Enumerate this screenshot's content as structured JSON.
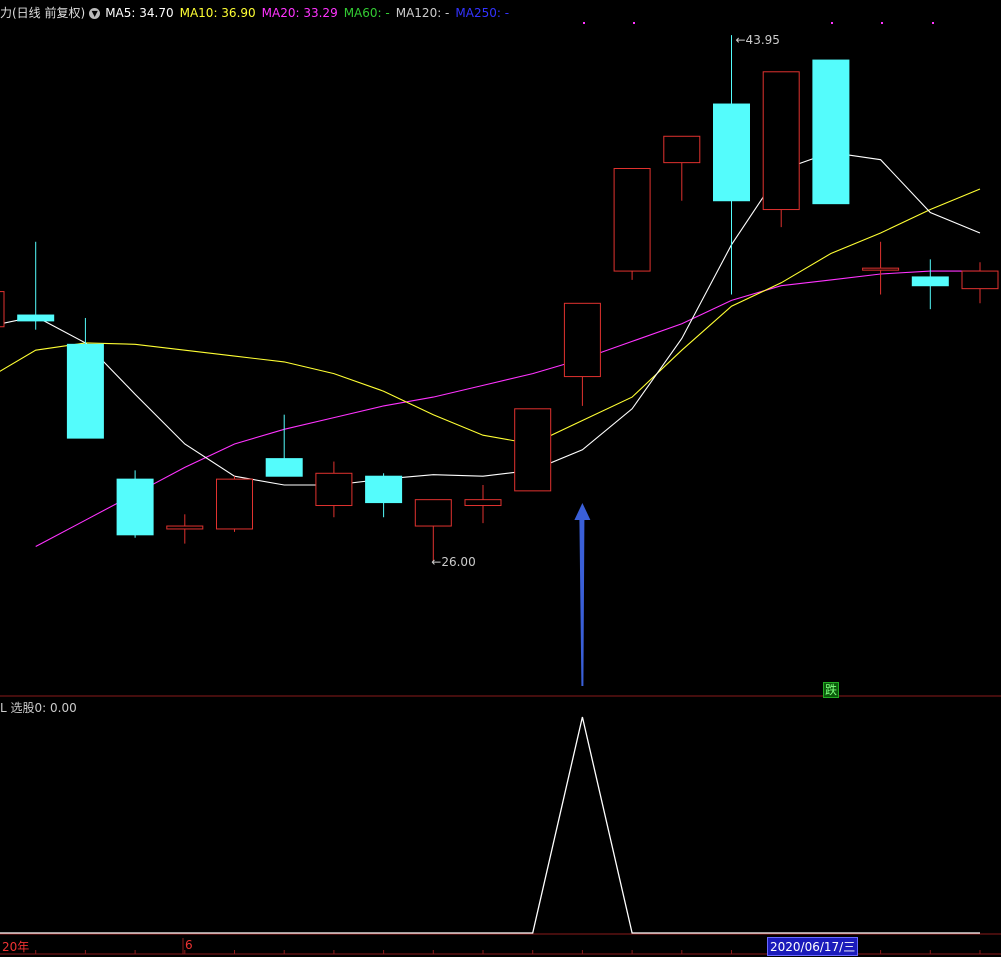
{
  "header": {
    "title": "力(日线 前复权)",
    "ma5": "MA5: 34.70",
    "ma10": "MA10: 36.90",
    "ma20": "MA20: 33.29",
    "ma60": "MA60: -",
    "ma120": "MA120: -",
    "ma250": "MA250: -"
  },
  "sub_indicator": {
    "label": "L  选股0: 0.00"
  },
  "axis": {
    "year_label": "20年",
    "month_label": "6",
    "date_badge": "2020/06/17/三"
  },
  "signal_badge": "跌",
  "colors": {
    "up": "#e0322f",
    "down": "#54fcfc",
    "ma5": "#ffffff",
    "ma10": "#ffff33",
    "ma20": "#ff33ff",
    "ma60": "#33cc33",
    "ma120": "#cccccc",
    "ma250": "#3333ff",
    "signal": "#3a5fd8",
    "grid": "#8a1a1a"
  },
  "chart_data": {
    "type": "candlestick",
    "price_axis": {
      "min": 21.4,
      "max": 45.15
    },
    "annotations": {
      "high": "43.95",
      "low": "26.00"
    },
    "candles": [
      {
        "open": 34.0,
        "close": 35.2,
        "high": 35.2,
        "low": 34.0
      },
      {
        "open": 34.4,
        "close": 34.2,
        "high": 36.9,
        "low": 33.9
      },
      {
        "open": 33.4,
        "close": 30.2,
        "high": 34.3,
        "low": 30.2
      },
      {
        "open": 28.8,
        "close": 26.9,
        "high": 29.1,
        "low": 26.8
      },
      {
        "open": 27.1,
        "close": 27.2,
        "high": 27.6,
        "low": 26.6
      },
      {
        "open": 27.1,
        "close": 28.8,
        "high": 28.9,
        "low": 27.0
      },
      {
        "open": 29.5,
        "close": 28.9,
        "high": 31.0,
        "low": 28.9
      },
      {
        "open": 27.9,
        "close": 29.0,
        "high": 29.4,
        "low": 27.5
      },
      {
        "open": 28.9,
        "close": 28.0,
        "high": 29.0,
        "low": 27.5
      },
      {
        "open": 27.2,
        "close": 28.1,
        "high": 28.1,
        "low": 26.0
      },
      {
        "open": 27.9,
        "close": 28.1,
        "high": 28.6,
        "low": 27.3
      },
      {
        "open": 28.4,
        "close": 31.2,
        "high": 31.2,
        "low": 28.4
      },
      {
        "open": 32.3,
        "close": 34.8,
        "high": 34.8,
        "low": 31.3
      },
      {
        "open": 35.9,
        "close": 39.4,
        "high": 39.4,
        "low": 35.6
      },
      {
        "open": 39.6,
        "close": 40.5,
        "high": 40.5,
        "low": 38.3
      },
      {
        "open": 41.6,
        "close": 38.3,
        "high": 43.95,
        "low": 35.1
      },
      {
        "open": 38.0,
        "close": 42.7,
        "high": 42.7,
        "low": 37.4
      },
      {
        "open": 43.1,
        "close": 38.2,
        "high": 43.1,
        "low": 38.2
      },
      {
        "open": 36.0,
        "close": 36.0,
        "high": 36.9,
        "low": 35.1
      },
      {
        "open": 35.7,
        "close": 35.4,
        "high": 36.3,
        "low": 34.6
      },
      {
        "open": 35.3,
        "close": 35.9,
        "high": 36.2,
        "low": 34.8
      }
    ],
    "ma5": [
      null,
      34.35,
      33.45,
      null,
      null,
      null,
      null,
      null,
      28.9,
      28.95,
      28.9,
      29.1,
      29.8,
      31.2,
      33.6,
      36.8,
      39.35,
      39.95,
      39.7,
      37.9,
      37.2
    ],
    "ma10": [
      33.2,
      34.1,
      34.2,
      null,
      null,
      null,
      null,
      null,
      null,
      29.5,
      28.9,
      28.8,
      29.0,
      30.1,
      31.6,
      33.2,
      34.7,
      35.5,
      36.0,
      36.5,
      37.1
    ],
    "ma20": [
      null,
      null,
      null,
      null,
      null,
      null,
      null,
      null,
      null,
      null,
      null,
      29.6,
      30.0,
      30.7,
      31.3,
      31.8,
      32.5,
      32.8,
      33.0,
      33.1,
      33.2
    ]
  },
  "sub_chart": {
    "series": [
      0,
      0,
      0,
      0,
      0,
      0,
      0,
      0,
      0,
      0,
      0,
      0,
      1,
      0,
      0,
      0,
      0,
      0,
      0,
      0,
      0
    ]
  }
}
